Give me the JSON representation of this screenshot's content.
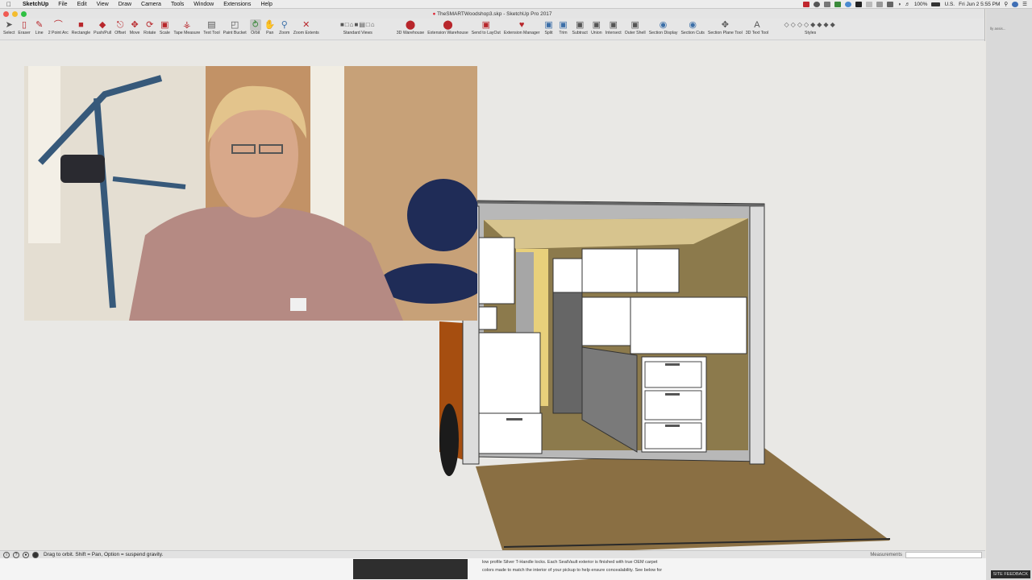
{
  "menubar": {
    "app": "SketchUp",
    "menus": [
      "File",
      "Edit",
      "View",
      "Draw",
      "Camera",
      "Tools",
      "Window",
      "Extensions",
      "Help"
    ],
    "battery": "100%",
    "locale": "U.S.",
    "clock": "Fri Jun 2  5:55 PM"
  },
  "window": {
    "title": "TheSMARTWoodshop3.skp - SketchUp Pro 2017"
  },
  "toolbar": {
    "tools": [
      {
        "label": "Select",
        "icon": "select-arrow-icon"
      },
      {
        "label": "Eraser",
        "icon": "eraser-icon"
      },
      {
        "label": "Line",
        "icon": "pencil-icon"
      },
      {
        "label": "2 Point Arc",
        "icon": "arc-icon"
      },
      {
        "label": "Rectangle",
        "icon": "rectangle-icon"
      },
      {
        "label": "Push/Pull",
        "icon": "push-pull-icon"
      },
      {
        "label": "Offset",
        "icon": "offset-icon"
      },
      {
        "label": "Move",
        "icon": "move-icon"
      },
      {
        "label": "Rotate",
        "icon": "rotate-icon"
      },
      {
        "label": "Scale",
        "icon": "scale-icon"
      },
      {
        "label": "Tape Measure",
        "icon": "tape-measure-icon"
      },
      {
        "label": "Text Tool",
        "icon": "text-icon"
      },
      {
        "label": "Paint Bucket",
        "icon": "paint-bucket-icon"
      },
      {
        "label": "Orbit",
        "icon": "orbit-icon"
      },
      {
        "label": "Pan",
        "icon": "pan-icon"
      },
      {
        "label": "Zoom",
        "icon": "zoom-icon"
      },
      {
        "label": "Zoom Extents",
        "icon": "zoom-extents-icon"
      }
    ],
    "standard_views_label": "Standard Views",
    "tools2": [
      {
        "label": "3D Warehouse",
        "icon": "warehouse-icon"
      },
      {
        "label": "Extension Warehouse",
        "icon": "extension-warehouse-icon"
      },
      {
        "label": "Send to LayOut",
        "icon": "layout-icon"
      },
      {
        "label": "Extension Manager",
        "icon": "extension-manager-icon"
      },
      {
        "label": "Split",
        "icon": "split-icon"
      },
      {
        "label": "Trim",
        "icon": "trim-icon"
      },
      {
        "label": "Subtract",
        "icon": "subtract-icon"
      },
      {
        "label": "Union",
        "icon": "union-icon"
      },
      {
        "label": "Intersect",
        "icon": "intersect-icon"
      },
      {
        "label": "Outer Shell",
        "icon": "outer-shell-icon"
      },
      {
        "label": "Section Display",
        "icon": "section-display-icon"
      },
      {
        "label": "Section Cuts",
        "icon": "section-cuts-icon"
      },
      {
        "label": "Section Plane Tool",
        "icon": "section-plane-icon"
      },
      {
        "label": "3D Text Tool",
        "icon": "3d-text-icon"
      }
    ],
    "styles_label": "Styles",
    "active_tool": "Orbit"
  },
  "status": {
    "hint": "Drag to orbit. Shift = Pan, Option = suspend gravity.",
    "measurements_label": "Measurements",
    "measurements_value": ""
  },
  "background": {
    "side_snippet": "lly assis...",
    "feedback": "SITE FEEDBACK",
    "page_text_1": "low profile Silver T-Handle locks. Each SeatVault exterior is finished with true OEM carpet",
    "page_text_2": "colors made to match the interior of your pickup to help ensure concealability. See below for"
  },
  "colors": {
    "accent_red": "#b8262b",
    "floor": "#8a6f43",
    "wall": "#8c7a4c",
    "cabinet": "#ffffff"
  }
}
